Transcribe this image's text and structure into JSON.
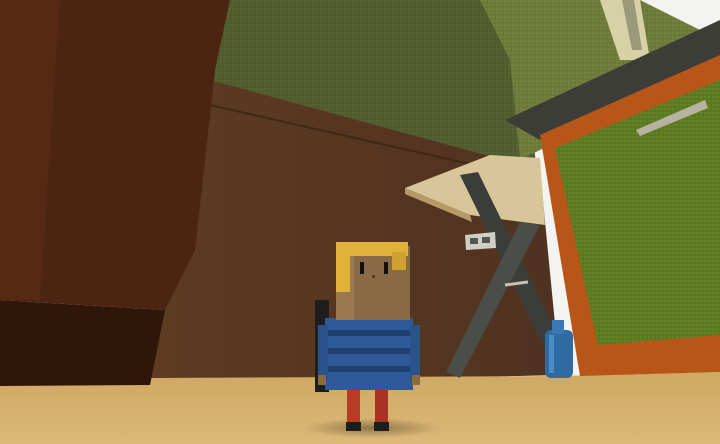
{
  "game": {
    "view": "third-person",
    "player_character": "blocky-kid",
    "hud_text": []
  },
  "palette": {
    "sky": "#f2f2ee",
    "wall_green_dark": "#4f5a2e",
    "wall_green_light": "#6f7a3a",
    "wainscot_brown": "#5a3820",
    "floor_sand": "#d9b472",
    "cabinet_brown": "#4a2310",
    "bin_green": "#5e7d24",
    "bin_orange": "#b8561a",
    "shirt_blue": "#2e5a99",
    "pants_red": "#b83b26",
    "hair_yellow": "#e1b23a"
  }
}
